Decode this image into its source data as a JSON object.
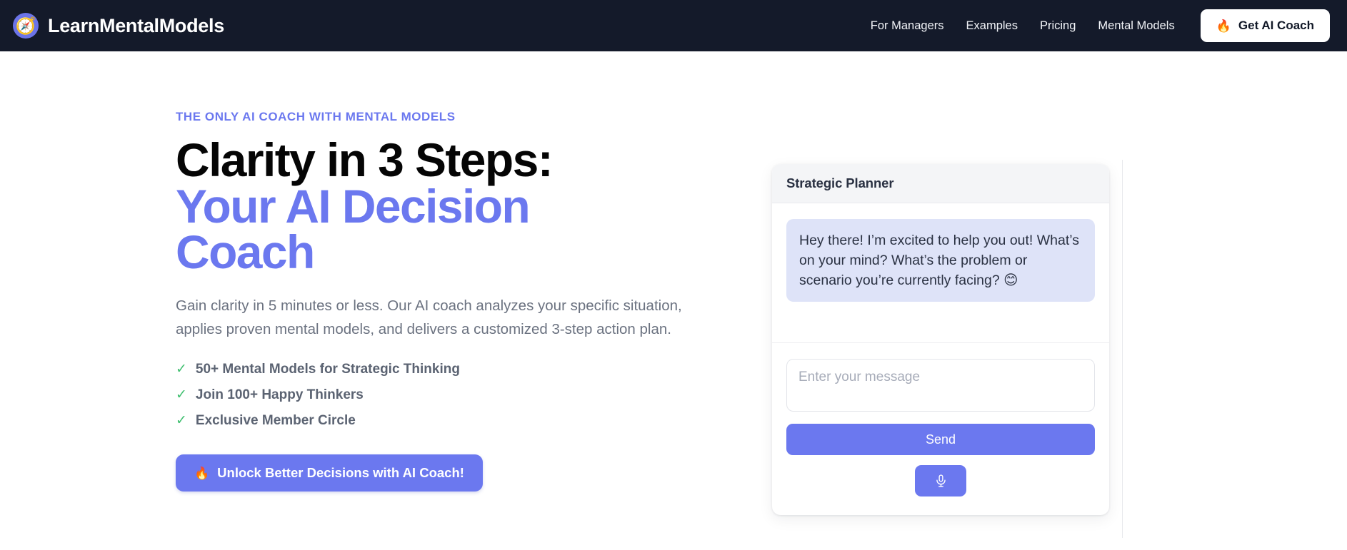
{
  "header": {
    "brand": {
      "logo_icon": "compass-icon",
      "logo_glyph": "🧭",
      "name": "LearnMentalModels"
    },
    "nav": [
      {
        "label": "For Managers"
      },
      {
        "label": "Examples"
      },
      {
        "label": "Pricing"
      },
      {
        "label": "Mental Models"
      }
    ],
    "cta": {
      "icon": "flame-icon",
      "icon_glyph": "🔥",
      "label": "Get AI Coach"
    },
    "background_color": "#141a2a"
  },
  "hero": {
    "eyebrow": "THE ONLY AI COACH WITH MENTAL MODELS",
    "headline_line1": "Clarity in 3 Steps:",
    "headline_line2": "Your AI Decision Coach",
    "lede": "Gain clarity in 5 minutes or less. Our AI coach analyzes your specific situation, applies proven mental models, and delivers a customized 3-step action plan.",
    "benefits": [
      {
        "check": "✓",
        "label": "50+ Mental Models for Strategic Thinking"
      },
      {
        "check": "✓",
        "label": "Join 100+ Happy Thinkers"
      },
      {
        "check": "✓",
        "label": "Exclusive Member Circle"
      }
    ],
    "cta": {
      "icon": "flame-icon",
      "icon_glyph": "🔥",
      "label": "Unlock Better Decisions with AI Coach!"
    },
    "accent_color": "#6b78ef",
    "check_color": "#3fbf6f"
  },
  "chat": {
    "title": "Strategic Planner",
    "messages": [
      {
        "role": "assistant",
        "text": "Hey there! I’m excited to help you out! What’s on your mind? What’s the problem or scenario you’re currently facing? 😊",
        "bubble_color": "#dee3f8"
      }
    ],
    "input": {
      "value": "",
      "placeholder": "Enter your message"
    },
    "send_label": "Send",
    "mic_icon": "microphone-icon",
    "header_background": "#f4f5f7"
  }
}
